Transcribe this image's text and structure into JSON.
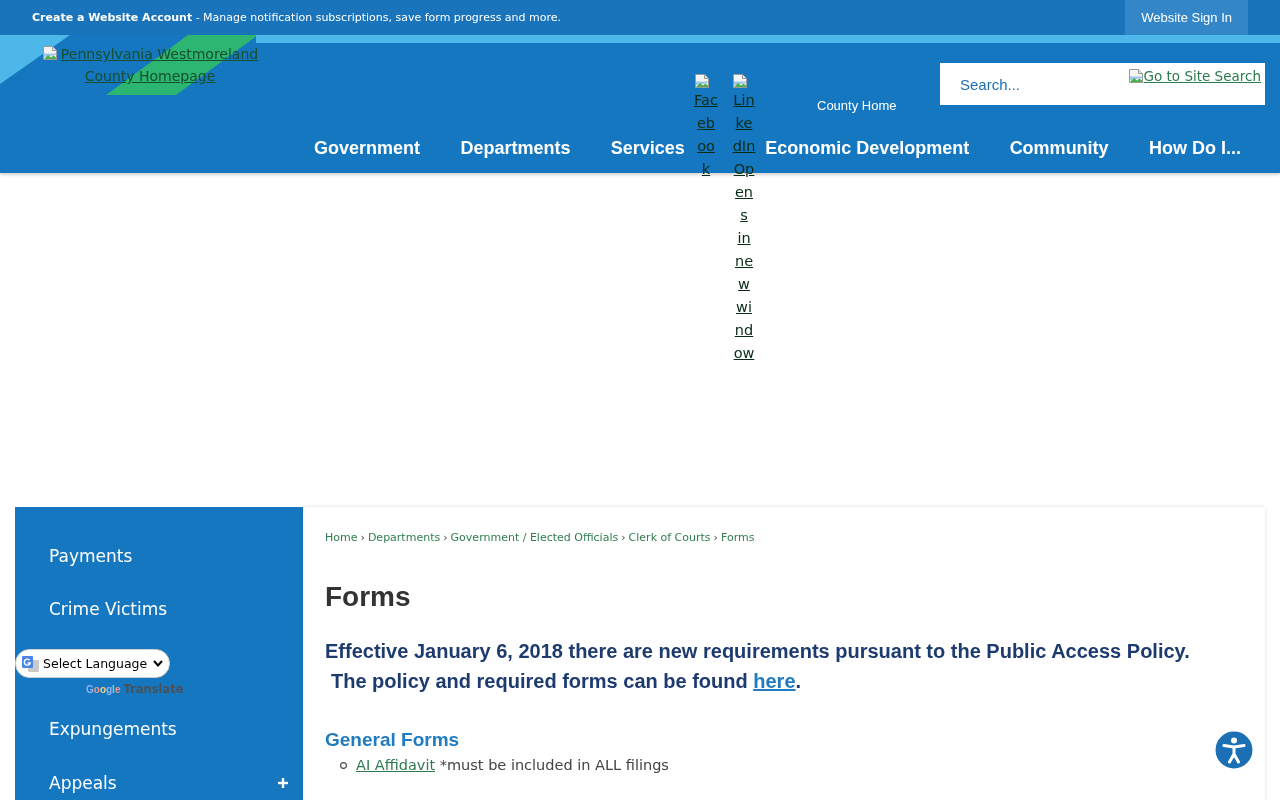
{
  "account_banner": {
    "link": "Create a Website Account",
    "text": " - Manage notification subscriptions, save form progress and more.",
    "sign_in": "Website Sign In"
  },
  "header": {
    "logo_alt": "Pennsylvania Westmoreland County Homepage",
    "social_links": [
      {
        "label": "Facebook"
      },
      {
        "label": "LinkedIn Opens in new window"
      }
    ],
    "county_home": "County Home",
    "search": {
      "placeholder": "Search...",
      "button_alt": "Go to Site Search"
    }
  },
  "nav": [
    "Government",
    "Departments",
    "Services",
    "Economic Development",
    "Community",
    "How Do I..."
  ],
  "sidebar": {
    "items": [
      {
        "kind": "link",
        "label": "Payments",
        "expandable": false
      },
      {
        "kind": "link",
        "label": "Crime Victims",
        "expandable": false
      },
      {
        "kind": "language_widget",
        "select": "Select Language",
        "brand": "Google",
        "label": "Translate"
      },
      {
        "kind": "link",
        "label": "Expungements",
        "expandable": false
      },
      {
        "kind": "link",
        "label": "Appeals",
        "expandable": true
      }
    ]
  },
  "content": {
    "breadcrumb": [
      {
        "label": "Home"
      },
      {
        "separator": "›",
        "label": "Departments"
      },
      {
        "separator": "›",
        "label": "Government / Elected Officials"
      },
      {
        "separator": "›",
        "label": "Clerk of Courts"
      },
      {
        "separator": "›",
        "label": "Forms"
      }
    ],
    "title": "Forms",
    "notice": {
      "line_1": "Effective January 6, 2018 there are new requirements pursuant to the Public Access Policy.",
      "line_2": "The policy and required forms can be found ",
      "link": "here",
      "end": "."
    },
    "sections": [
      {
        "heading": "General Forms",
        "items": [
          {
            "link": "AI Affidavit",
            "note": " *must be included in ALL filings"
          }
        ]
      }
    ]
  }
}
